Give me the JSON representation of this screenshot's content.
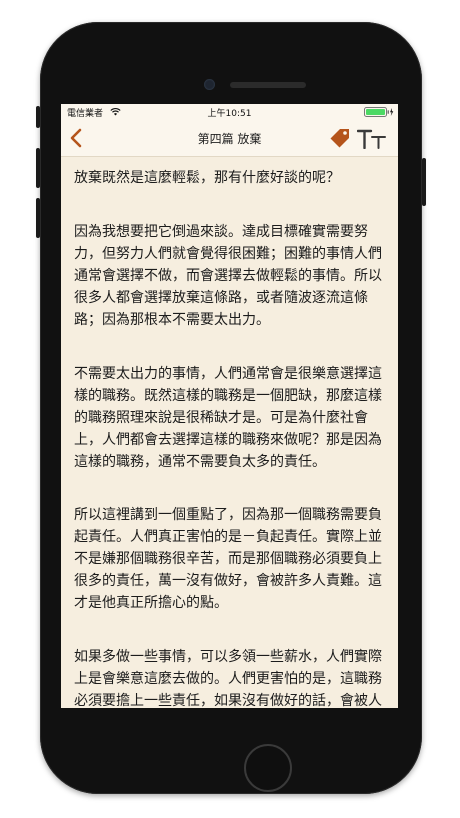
{
  "status_bar": {
    "carrier": "電信業者",
    "time": "上午10:51"
  },
  "nav": {
    "title": "第四篇 放棄",
    "icons": [
      "chevron-left-icon",
      "tag-icon",
      "font-size-icon"
    ],
    "accent_color": "#b5541b"
  },
  "content": {
    "paragraphs": [
      "放棄既然是這麼輕鬆，那有什麼好談的呢？",
      "因為我想要把它倒過來談。達成目標確實需要努力，但努力人們就會覺得很困難；困難的事情人們通常會選擇不做，而會選擇去做輕鬆的事情。所以很多人都會選擇放棄這條路，或者隨波逐流這條路；因為那根本不需要太出力。",
      "不需要太出力的事情，人們通常會是很樂意選擇這樣的職務。既然這樣的職務是一個肥缺，那麼這樣的職務照理來說是很稀缺才是。可是為什麼社會上，人們都會去選擇這樣的職務來做呢？那是因為這樣的職務，通常不需要負太多的責任。",
      "所以這裡講到一個重點了，因為那一個職務需要負起責任。人們真正害怕的是－負起責任。實際上並不是嫌那個職務很辛苦，而是那個職務必須要負上很多的責任，萬一沒有做好，會被許多人責難。這才是他真正所擔心的點。",
      "如果多做一些事情，可以多領一些薪水，人們實際上是會樂意這麼去做的。人們更害怕的是，這職務必須要擔上一些責任，如果沒有做好的話，會被人"
    ]
  }
}
